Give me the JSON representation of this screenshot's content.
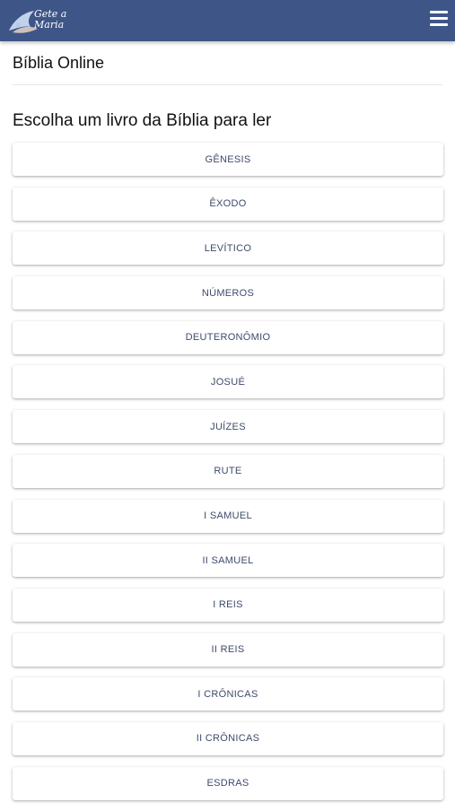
{
  "header": {
    "logo_text": "Gete a\nMaria",
    "menu_icon": "hamburger-menu-icon",
    "bar_color": "#3e5587"
  },
  "page": {
    "title": "Bíblia Online",
    "heading": "Escolha um livro da Bíblia para ler"
  },
  "books": [
    {
      "label": "GÊNESIS"
    },
    {
      "label": "ÊXODO"
    },
    {
      "label": "LEVÍTICO"
    },
    {
      "label": "NÚMEROS"
    },
    {
      "label": "DEUTERONÔMIO"
    },
    {
      "label": "JOSUÉ"
    },
    {
      "label": "JUÍZES"
    },
    {
      "label": "RUTE"
    },
    {
      "label": "I SAMUEL"
    },
    {
      "label": "II SAMUEL"
    },
    {
      "label": "I REIS"
    },
    {
      "label": "II REIS"
    },
    {
      "label": "I CRÔNICAS"
    },
    {
      "label": "II CRÔNICAS"
    },
    {
      "label": "ESDRAS"
    }
  ]
}
